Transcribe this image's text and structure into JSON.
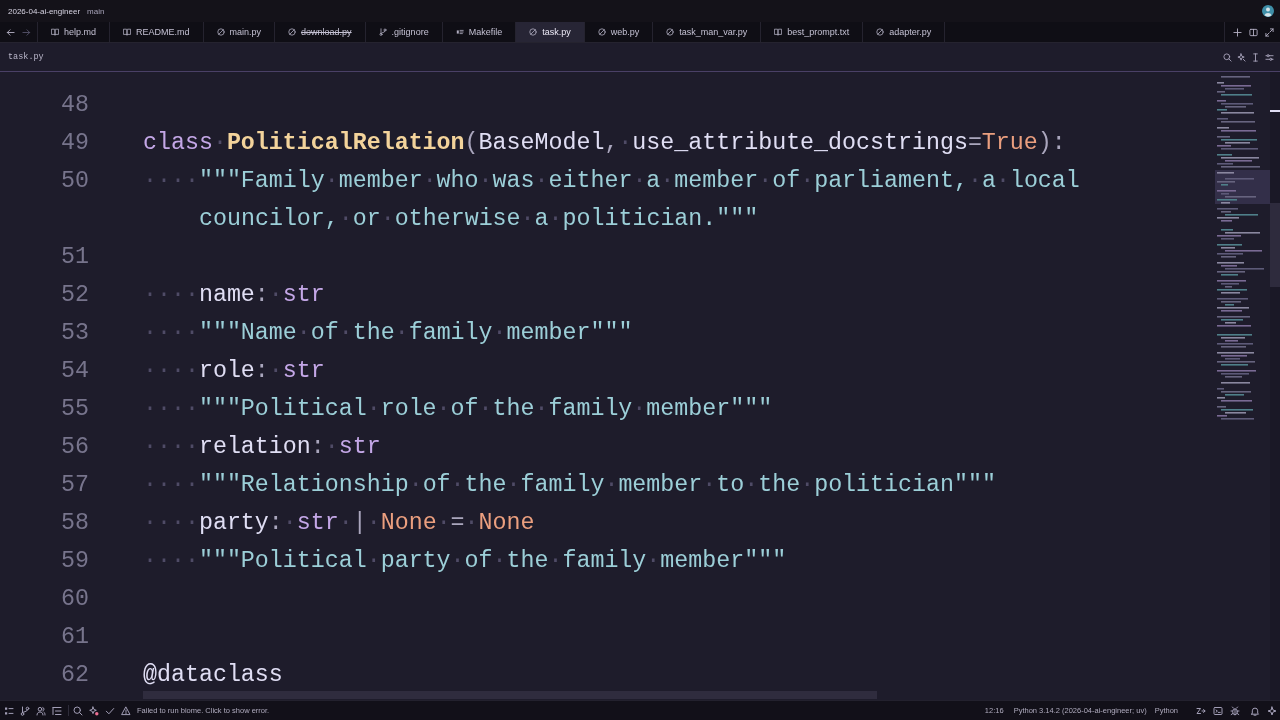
{
  "title_bar": {
    "project": "2026-04-ai-engineer",
    "branch": "main"
  },
  "tabs": [
    {
      "label": "help.md",
      "kind": "markdown",
      "selected": false,
      "deleted": false
    },
    {
      "label": "README.md",
      "kind": "markdown",
      "selected": false,
      "deleted": false
    },
    {
      "label": "main.py",
      "kind": "python",
      "selected": false,
      "deleted": false
    },
    {
      "label": "download.py",
      "kind": "python",
      "selected": false,
      "deleted": true
    },
    {
      "label": ".gitignore",
      "kind": "git",
      "selected": false,
      "deleted": false
    },
    {
      "label": "Makefile",
      "kind": "makefile",
      "selected": false,
      "deleted": false
    },
    {
      "label": "task.py",
      "kind": "python",
      "selected": true,
      "deleted": false
    },
    {
      "label": "web.py",
      "kind": "python",
      "selected": false,
      "deleted": false
    },
    {
      "label": "task_man_var.py",
      "kind": "python",
      "selected": false,
      "deleted": false
    },
    {
      "label": "best_prompt.txt",
      "kind": "text",
      "selected": false,
      "deleted": false
    },
    {
      "label": "adapter.py",
      "kind": "python",
      "selected": false,
      "deleted": false
    }
  ],
  "breadcrumb": "task.py",
  "editor": {
    "lines": [
      {
        "number": "48"
      },
      {
        "number": "49",
        "visual_rows": [
          {
            "tokens": [
              {
                "text": "class",
                "kind": "keyword"
              },
              {
                "text": "·",
                "kind": "whitespace"
              },
              {
                "text": "PoliticalRelation",
                "kind": "type"
              },
              {
                "text": "(",
                "kind": "punctuation"
              },
              {
                "text": "BaseModel",
                "kind": "name"
              },
              {
                "text": ",",
                "kind": "punctuation"
              },
              {
                "text": "·",
                "kind": "whitespace"
              },
              {
                "text": "use_attribute_docstrings",
                "kind": "name"
              },
              {
                "text": "=",
                "kind": "punctuation"
              },
              {
                "text": "True",
                "kind": "constant"
              },
              {
                "text": "):",
                "kind": "punctuation"
              }
            ]
          }
        ]
      },
      {
        "number": "50",
        "visual_rows": [
          {
            "tokens": [
              {
                "text": "····",
                "kind": "whitespace"
              },
              {
                "text": "\"\"\"Family",
                "kind": "string"
              },
              {
                "text": "·",
                "kind": "whitespace"
              },
              {
                "text": "member",
                "kind": "string"
              },
              {
                "text": "·",
                "kind": "whitespace"
              },
              {
                "text": "who",
                "kind": "string"
              },
              {
                "text": "·",
                "kind": "whitespace"
              },
              {
                "text": "was",
                "kind": "string"
              },
              {
                "text": "·",
                "kind": "whitespace"
              },
              {
                "text": "either",
                "kind": "string"
              },
              {
                "text": "·",
                "kind": "whitespace"
              },
              {
                "text": "a",
                "kind": "string"
              },
              {
                "text": "·",
                "kind": "whitespace"
              },
              {
                "text": "member",
                "kind": "string"
              },
              {
                "text": "·",
                "kind": "whitespace"
              },
              {
                "text": "of",
                "kind": "string"
              },
              {
                "text": "·",
                "kind": "whitespace"
              },
              {
                "text": "parliament,",
                "kind": "string"
              },
              {
                "text": "·",
                "kind": "whitespace"
              },
              {
                "text": "a",
                "kind": "string"
              },
              {
                "text": "·",
                "kind": "whitespace"
              },
              {
                "text": "local",
                "kind": "string"
              }
            ]
          },
          {
            "tokens": [
              {
                "text": "councilor,",
                "kind": "string"
              },
              {
                "text": "·",
                "kind": "whitespace"
              },
              {
                "text": "or",
                "kind": "string"
              },
              {
                "text": "·",
                "kind": "whitespace"
              },
              {
                "text": "otherwise",
                "kind": "string"
              },
              {
                "text": "·",
                "kind": "whitespace"
              },
              {
                "text": "a",
                "kind": "string"
              },
              {
                "text": "·",
                "kind": "whitespace"
              },
              {
                "text": "politician.\"\"\"",
                "kind": "string"
              }
            ]
          }
        ]
      },
      {
        "number": "51"
      },
      {
        "number": "52",
        "visual_rows": [
          {
            "tokens": [
              {
                "text": "····",
                "kind": "whitespace"
              },
              {
                "text": "name",
                "kind": "name"
              },
              {
                "text": ":",
                "kind": "punctuation"
              },
              {
                "text": "·",
                "kind": "whitespace"
              },
              {
                "text": "str",
                "kind": "builtin"
              }
            ]
          }
        ]
      },
      {
        "number": "53",
        "visual_rows": [
          {
            "tokens": [
              {
                "text": "····",
                "kind": "whitespace"
              },
              {
                "text": "\"\"\"Name",
                "kind": "string"
              },
              {
                "text": "·",
                "kind": "whitespace"
              },
              {
                "text": "of",
                "kind": "string"
              },
              {
                "text": "·",
                "kind": "whitespace"
              },
              {
                "text": "the",
                "kind": "string"
              },
              {
                "text": "·",
                "kind": "whitespace"
              },
              {
                "text": "family",
                "kind": "string"
              },
              {
                "text": "·",
                "kind": "whitespace"
              },
              {
                "text": "member\"\"\"",
                "kind": "string"
              }
            ]
          }
        ]
      },
      {
        "number": "54",
        "visual_rows": [
          {
            "tokens": [
              {
                "text": "····",
                "kind": "whitespace"
              },
              {
                "text": "role",
                "kind": "name"
              },
              {
                "text": ":",
                "kind": "punctuation"
              },
              {
                "text": "·",
                "kind": "whitespace"
              },
              {
                "text": "str",
                "kind": "builtin"
              }
            ]
          }
        ]
      },
      {
        "number": "55",
        "visual_rows": [
          {
            "tokens": [
              {
                "text": "····",
                "kind": "whitespace"
              },
              {
                "text": "\"\"\"Political",
                "kind": "string"
              },
              {
                "text": "·",
                "kind": "whitespace"
              },
              {
                "text": "role",
                "kind": "string"
              },
              {
                "text": "·",
                "kind": "whitespace"
              },
              {
                "text": "of",
                "kind": "string"
              },
              {
                "text": "·",
                "kind": "whitespace"
              },
              {
                "text": "the",
                "kind": "string"
              },
              {
                "text": "·",
                "kind": "whitespace"
              },
              {
                "text": "family",
                "kind": "string"
              },
              {
                "text": "·",
                "kind": "whitespace"
              },
              {
                "text": "member\"\"\"",
                "kind": "string"
              }
            ]
          }
        ]
      },
      {
        "number": "56",
        "visual_rows": [
          {
            "tokens": [
              {
                "text": "····",
                "kind": "whitespace"
              },
              {
                "text": "relation",
                "kind": "name"
              },
              {
                "text": ":",
                "kind": "punctuation"
              },
              {
                "text": "·",
                "kind": "whitespace"
              },
              {
                "text": "str",
                "kind": "builtin"
              }
            ]
          }
        ]
      },
      {
        "number": "57",
        "visual_rows": [
          {
            "tokens": [
              {
                "text": "····",
                "kind": "whitespace"
              },
              {
                "text": "\"\"\"Relationship",
                "kind": "string"
              },
              {
                "text": "·",
                "kind": "whitespace"
              },
              {
                "text": "of",
                "kind": "string"
              },
              {
                "text": "·",
                "kind": "whitespace"
              },
              {
                "text": "the",
                "kind": "string"
              },
              {
                "text": "·",
                "kind": "whitespace"
              },
              {
                "text": "family",
                "kind": "string"
              },
              {
                "text": "·",
                "kind": "whitespace"
              },
              {
                "text": "member",
                "kind": "string"
              },
              {
                "text": "·",
                "kind": "whitespace"
              },
              {
                "text": "to",
                "kind": "string"
              },
              {
                "text": "·",
                "kind": "whitespace"
              },
              {
                "text": "the",
                "kind": "string"
              },
              {
                "text": "·",
                "kind": "whitespace"
              },
              {
                "text": "politician\"\"\"",
                "kind": "string"
              }
            ]
          }
        ]
      },
      {
        "number": "58",
        "visual_rows": [
          {
            "tokens": [
              {
                "text": "····",
                "kind": "whitespace"
              },
              {
                "text": "party",
                "kind": "name"
              },
              {
                "text": ":",
                "kind": "punctuation"
              },
              {
                "text": "·",
                "kind": "whitespace"
              },
              {
                "text": "str",
                "kind": "builtin"
              },
              {
                "text": "·",
                "kind": "whitespace"
              },
              {
                "text": "|",
                "kind": "punctuation"
              },
              {
                "text": "·",
                "kind": "whitespace"
              },
              {
                "text": "None",
                "kind": "constant"
              },
              {
                "text": "·",
                "kind": "whitespace"
              },
              {
                "text": "=",
                "kind": "punctuation"
              },
              {
                "text": "·",
                "kind": "whitespace"
              },
              {
                "text": "None",
                "kind": "constant"
              }
            ]
          }
        ]
      },
      {
        "number": "59",
        "visual_rows": [
          {
            "tokens": [
              {
                "text": "····",
                "kind": "whitespace"
              },
              {
                "text": "\"\"\"Political",
                "kind": "string"
              },
              {
                "text": "·",
                "kind": "whitespace"
              },
              {
                "text": "party",
                "kind": "string"
              },
              {
                "text": "·",
                "kind": "whitespace"
              },
              {
                "text": "of",
                "kind": "string"
              },
              {
                "text": "·",
                "kind": "whitespace"
              },
              {
                "text": "the",
                "kind": "string"
              },
              {
                "text": "·",
                "kind": "whitespace"
              },
              {
                "text": "family",
                "kind": "string"
              },
              {
                "text": "·",
                "kind": "whitespace"
              },
              {
                "text": "member\"\"\"",
                "kind": "string"
              }
            ]
          }
        ]
      },
      {
        "number": "60"
      },
      {
        "number": "61"
      },
      {
        "number": "62",
        "visual_rows": [
          {
            "tokens": [
              {
                "text": "@dataclass",
                "kind": "decorator"
              }
            ]
          }
        ]
      }
    ]
  },
  "status_bar": {
    "message": "Failed to run biome. Click to show error.",
    "cursor_position": "12:16",
    "toolchain": "Python 3.14.2 (2026-04-ai-engineer; uv)",
    "language": "Python"
  }
}
